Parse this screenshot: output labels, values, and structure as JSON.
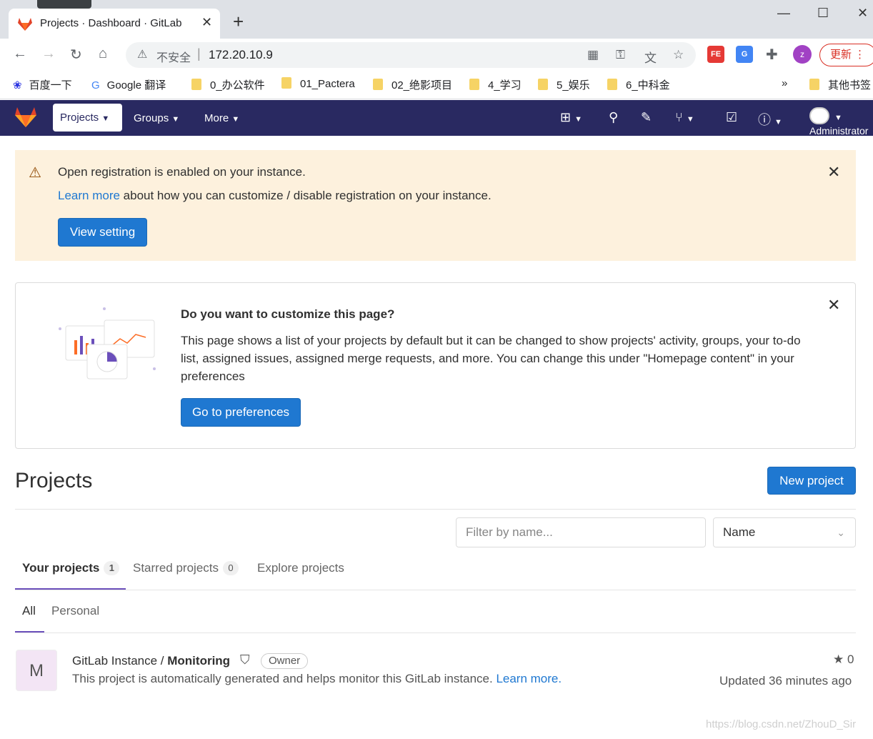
{
  "browser": {
    "tab_title": "Projects · Dashboard · GitLab",
    "new_tab": "+",
    "insecure_label": "不安全",
    "url": "172.20.10.9",
    "profile_initial": "z",
    "update_label": "更新",
    "extensions": [
      "FE"
    ],
    "bookmarks": [
      "百度一下",
      "Google 翻译",
      "0_办公软件",
      "01_Pactera",
      "02_绝影项目",
      "4_学习",
      "5_娱乐",
      "6_中科金"
    ],
    "bookmarks_overflow": "»",
    "bookmarks_other": "其他书签"
  },
  "gitlab_nav": {
    "projects": "Projects",
    "groups": "Groups",
    "more": "More",
    "user": "Administrator"
  },
  "registration_alert": {
    "title": "Open registration is enabled on your instance.",
    "link": "Learn more",
    "body": " about how you can customize / disable registration on your instance.",
    "button": "View setting"
  },
  "customize_box": {
    "title": "Do you want to customize this page?",
    "body": "This page shows a list of your projects by default but it can be changed to show projects' activity, groups, your to-do list, assigned issues, assigned merge requests, and more. You can change this under \"Homepage content\" in your preferences",
    "button": "Go to preferences"
  },
  "projects": {
    "title": "Projects",
    "new_button": "New project",
    "filter_placeholder": "Filter by name...",
    "sort_value": "Name",
    "tabs": [
      {
        "label": "Your projects",
        "count": "1"
      },
      {
        "label": "Starred projects",
        "count": "0"
      },
      {
        "label": "Explore projects"
      }
    ],
    "subtabs": [
      "All",
      "Personal"
    ],
    "items": [
      {
        "avatar_letter": "M",
        "namespace": "GitLab Instance / ",
        "name": "Monitoring",
        "role": "Owner",
        "description": "This project is automatically generated and helps monitor this GitLab instance. ",
        "description_link": "Learn more.",
        "stars": "0",
        "updated": "Updated 36 minutes ago"
      }
    ]
  },
  "watermark": "https://blog.csdn.net/ZhouD_Sir",
  "colors": {
    "nav_bg": "#292961",
    "primary": "#1f78d1",
    "alert_bg": "#fdf1dd",
    "tab_active": "#6b4fbb"
  }
}
